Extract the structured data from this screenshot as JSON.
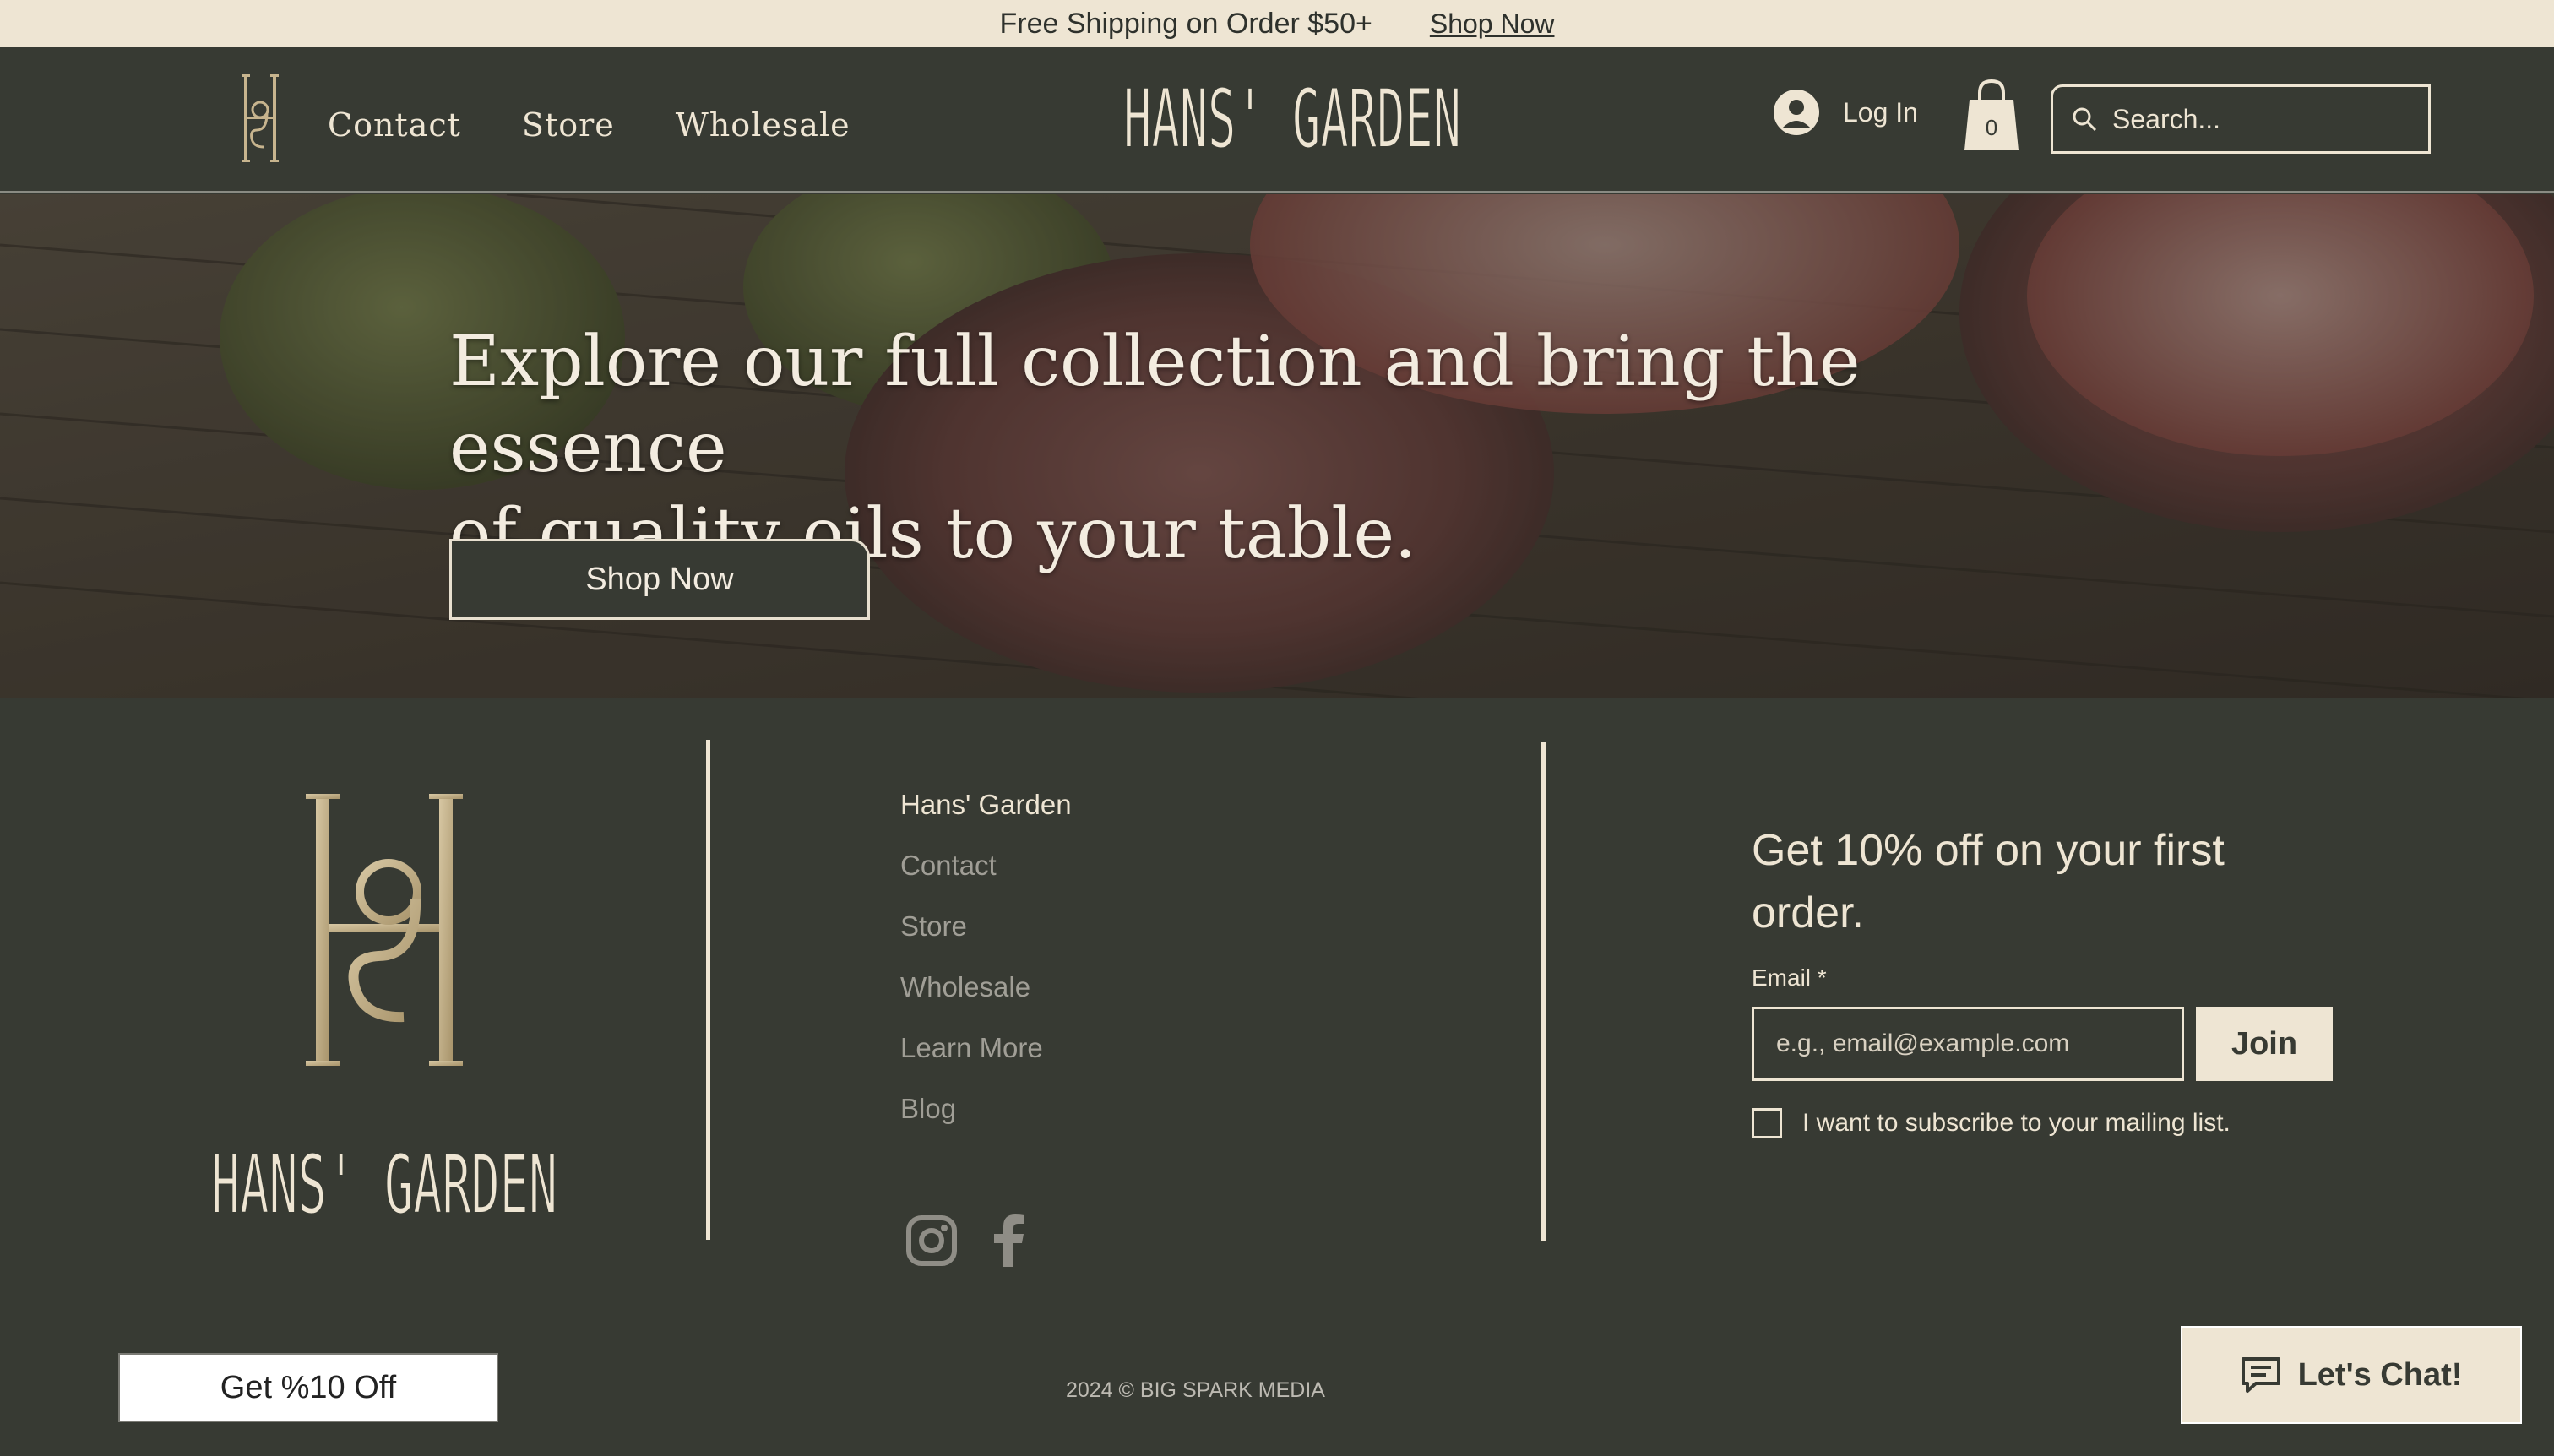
{
  "promo": {
    "text": "Free Shipping on Order $50+",
    "link": "Shop Now"
  },
  "header": {
    "nav": [
      "Contact",
      "Store",
      "Wholesale"
    ],
    "brand": "HANS' GARDEN",
    "login": "Log In",
    "cart_count": "0",
    "search_placeholder": "Search..."
  },
  "hero": {
    "heading_line1": "Explore our full collection and bring the essence",
    "heading_line2": "of quality oils to your table.",
    "button": "Shop Now"
  },
  "footer": {
    "brand": "HANS' GARDEN",
    "links": [
      "Hans' Garden",
      "Contact",
      "Store",
      "Wholesale",
      "Learn More",
      "Blog"
    ],
    "newsletter": {
      "heading": "Get 10% off on your first order.",
      "email_label": "Email *",
      "email_placeholder": "e.g., email@example.com",
      "join": "Join",
      "subscribe_label": "I want to subscribe to your mailing list."
    },
    "discount_button": "Get %10 Off",
    "copyright": "2024 © BIG SPARK MEDIA",
    "chat": "Let's Chat!"
  },
  "colors": {
    "dark": "#373a33",
    "cream": "#eee5d3",
    "gold": "#c7b48e"
  },
  "icons": [
    "monogram-logo",
    "user-icon",
    "shopping-bag-icon",
    "search-icon",
    "instagram-icon",
    "facebook-icon",
    "chat-icon"
  ]
}
